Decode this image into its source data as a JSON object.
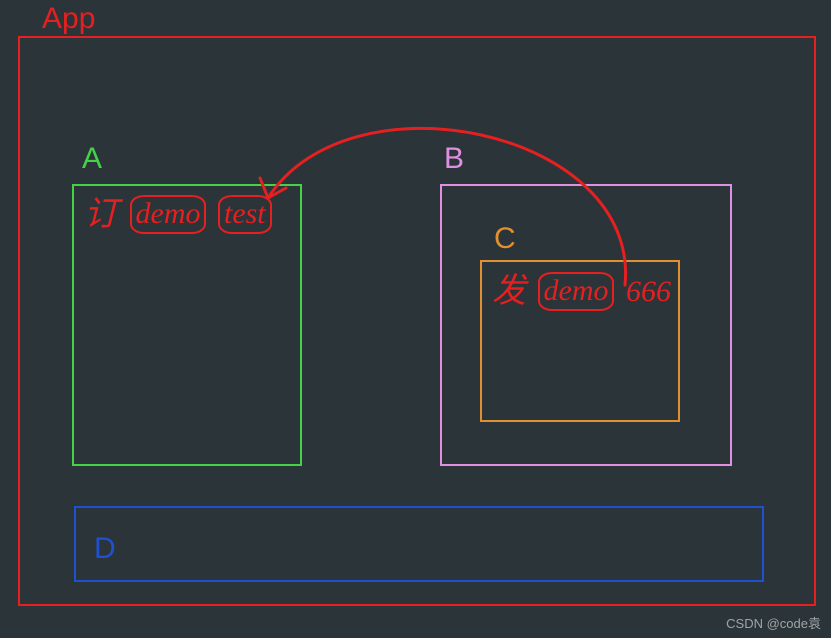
{
  "app": {
    "label": "App"
  },
  "boxes": {
    "a": {
      "label": "A"
    },
    "b": {
      "label": "B"
    },
    "c": {
      "label": "C"
    },
    "d": {
      "label": "D"
    }
  },
  "annotations": {
    "a_prefix": "订",
    "a_word1": "demo",
    "a_word2": "test",
    "c_prefix": "发",
    "c_word1": "demo",
    "c_word2": "666"
  },
  "arrow": {
    "from": "C",
    "to": "A"
  },
  "watermark": "CSDN @code袁",
  "colors": {
    "bg": "#2a3439",
    "app": "#e62020",
    "a": "#46d246",
    "b": "#e090e0",
    "c": "#e09030",
    "d": "#2050d0",
    "ink": "#e62020"
  }
}
